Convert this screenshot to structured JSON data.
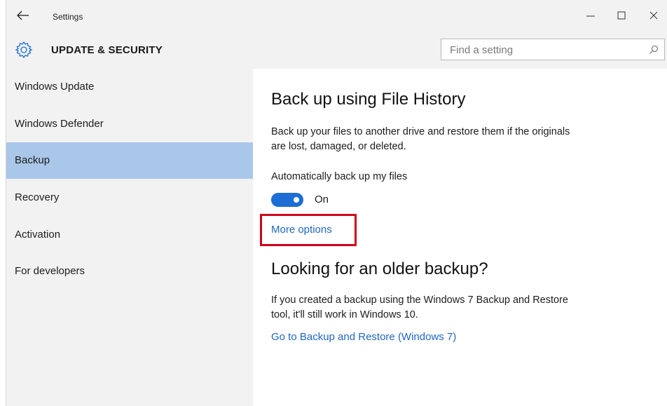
{
  "window": {
    "title": "Settings"
  },
  "header": {
    "section_title": "UPDATE & SECURITY",
    "search_placeholder": "Find a setting"
  },
  "sidebar": {
    "items": [
      {
        "label": "Windows Update",
        "selected": false
      },
      {
        "label": "Windows Defender",
        "selected": false
      },
      {
        "label": "Backup",
        "selected": true
      },
      {
        "label": "Recovery",
        "selected": false
      },
      {
        "label": "Activation",
        "selected": false
      },
      {
        "label": "For developers",
        "selected": false
      }
    ]
  },
  "main": {
    "file_history": {
      "heading": "Back up using File History",
      "description_line1": "Back up your files to another drive and restore them if the originals",
      "description_line2": "are lost, damaged, or deleted.",
      "auto_backup_label": "Automatically back up my files",
      "toggle_state": "On",
      "toggle_on": true,
      "more_options_link": "More options"
    },
    "older_backup": {
      "heading": "Looking for an older backup?",
      "description_line1": "If you created a backup using the Windows 7 Backup and Restore",
      "description_line2": "tool, it'll still work in Windows 10.",
      "link": "Go to Backup and Restore (Windows 7)"
    }
  },
  "colors": {
    "accent": "#1c6ed5",
    "link": "#1f66c1",
    "selected_item": "#a9c7e8",
    "highlight_box": "#d0021b"
  }
}
